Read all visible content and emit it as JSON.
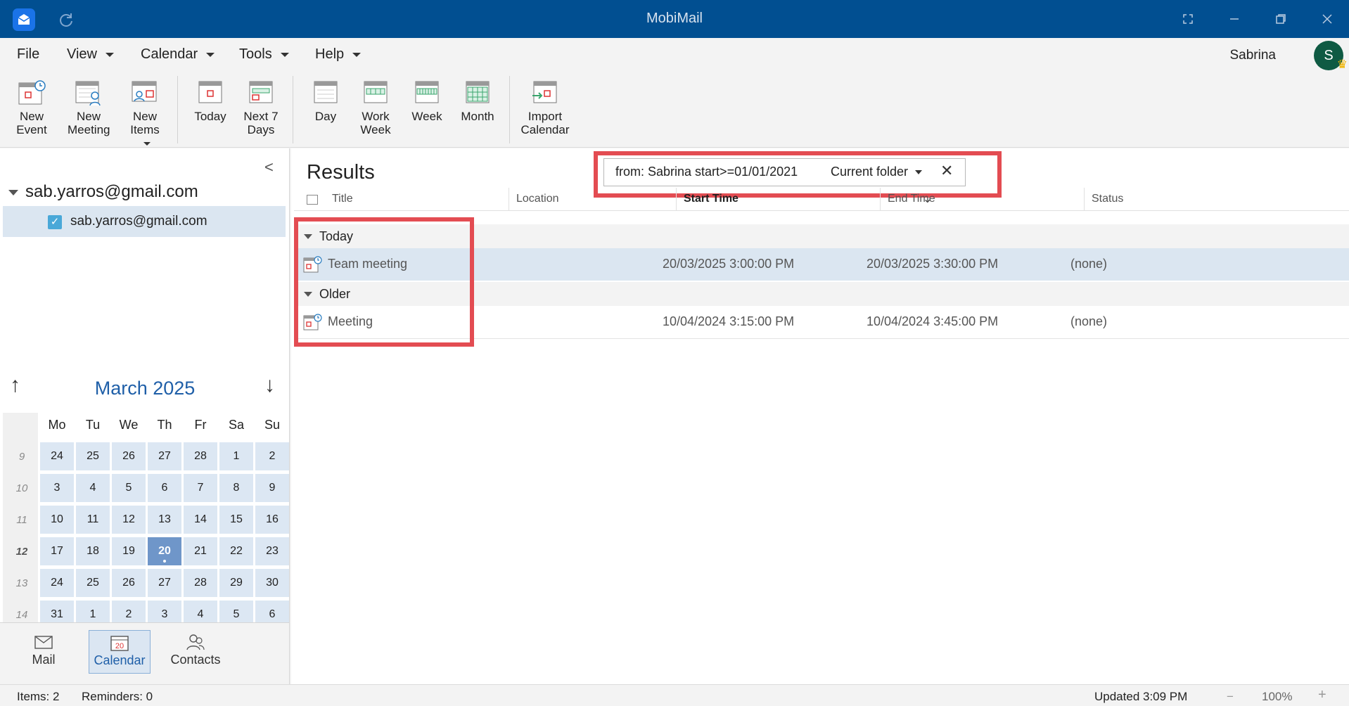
{
  "window": {
    "title": "MobiMail"
  },
  "menu": {
    "file": "File",
    "view": "View",
    "calendar": "Calendar",
    "tools": "Tools",
    "help": "Help"
  },
  "user": {
    "name": "Sabrina",
    "initial": "S"
  },
  "ribbon": {
    "new_event": [
      "New",
      "Event"
    ],
    "new_meeting": [
      "New",
      "Meeting"
    ],
    "new_items": [
      "New",
      "Items"
    ],
    "today": "Today",
    "next7": [
      "Next 7",
      "Days"
    ],
    "day": "Day",
    "work_week": [
      "Work",
      "Week"
    ],
    "week": "Week",
    "month": "Month",
    "import_calendar": [
      "Import",
      "Calendar"
    ]
  },
  "sidebar": {
    "account": "sab.yarros@gmail.com",
    "folder": "sab.yarros@gmail.com",
    "collapse_glyph": "<"
  },
  "mini_calendar": {
    "title": "March 2025",
    "days_of_week": [
      "Mo",
      "Tu",
      "We",
      "Th",
      "Fr",
      "Sa",
      "Su"
    ],
    "weeks": [
      {
        "number": "9",
        "days": [
          "24",
          "25",
          "26",
          "27",
          "28",
          "1",
          "2"
        ]
      },
      {
        "number": "10",
        "days": [
          "3",
          "4",
          "5",
          "6",
          "7",
          "8",
          "9"
        ]
      },
      {
        "number": "11",
        "days": [
          "10",
          "11",
          "12",
          "13",
          "14",
          "15",
          "16"
        ]
      },
      {
        "number": "12",
        "days": [
          "17",
          "18",
          "19",
          "20",
          "21",
          "22",
          "23"
        ]
      },
      {
        "number": "13",
        "days": [
          "24",
          "25",
          "26",
          "27",
          "28",
          "29",
          "30"
        ]
      },
      {
        "number": "14",
        "days": [
          "31",
          "1",
          "2",
          "3",
          "4",
          "5",
          "6"
        ]
      }
    ],
    "selected_day": "20"
  },
  "nav": {
    "mail": "Mail",
    "calendar": "Calendar",
    "calendar_icon_day": "20",
    "contacts": "Contacts"
  },
  "results": {
    "title": "Results",
    "search_query": "from: Sabrina start>=01/01/2021",
    "scope": "Current folder",
    "columns": {
      "title": "Title",
      "location": "Location",
      "start_time": "Start Time",
      "end_time": "End Time",
      "status": "Status"
    },
    "groups": [
      {
        "label": "Today",
        "items": [
          {
            "title": "Team meeting",
            "location": "",
            "start": "20/03/2025 3:00:00 PM",
            "end": "20/03/2025 3:30:00 PM",
            "status": "(none)"
          }
        ]
      },
      {
        "label": "Older",
        "items": [
          {
            "title": "Meeting",
            "location": "",
            "start": "10/04/2024 3:15:00 PM",
            "end": "10/04/2024 3:45:00 PM",
            "status": "(none)"
          }
        ]
      }
    ]
  },
  "status_bar": {
    "items": "Items: 2",
    "reminders": "Reminders: 0",
    "updated": "Updated 3:09 PM",
    "zoom": "100%",
    "zoom_out": "−",
    "zoom_in": "+"
  },
  "colors": {
    "titlebar": "#014f91",
    "accent": "#1f5fa8",
    "highlight_border": "#e34c52",
    "selection": "#dbe6f1"
  }
}
